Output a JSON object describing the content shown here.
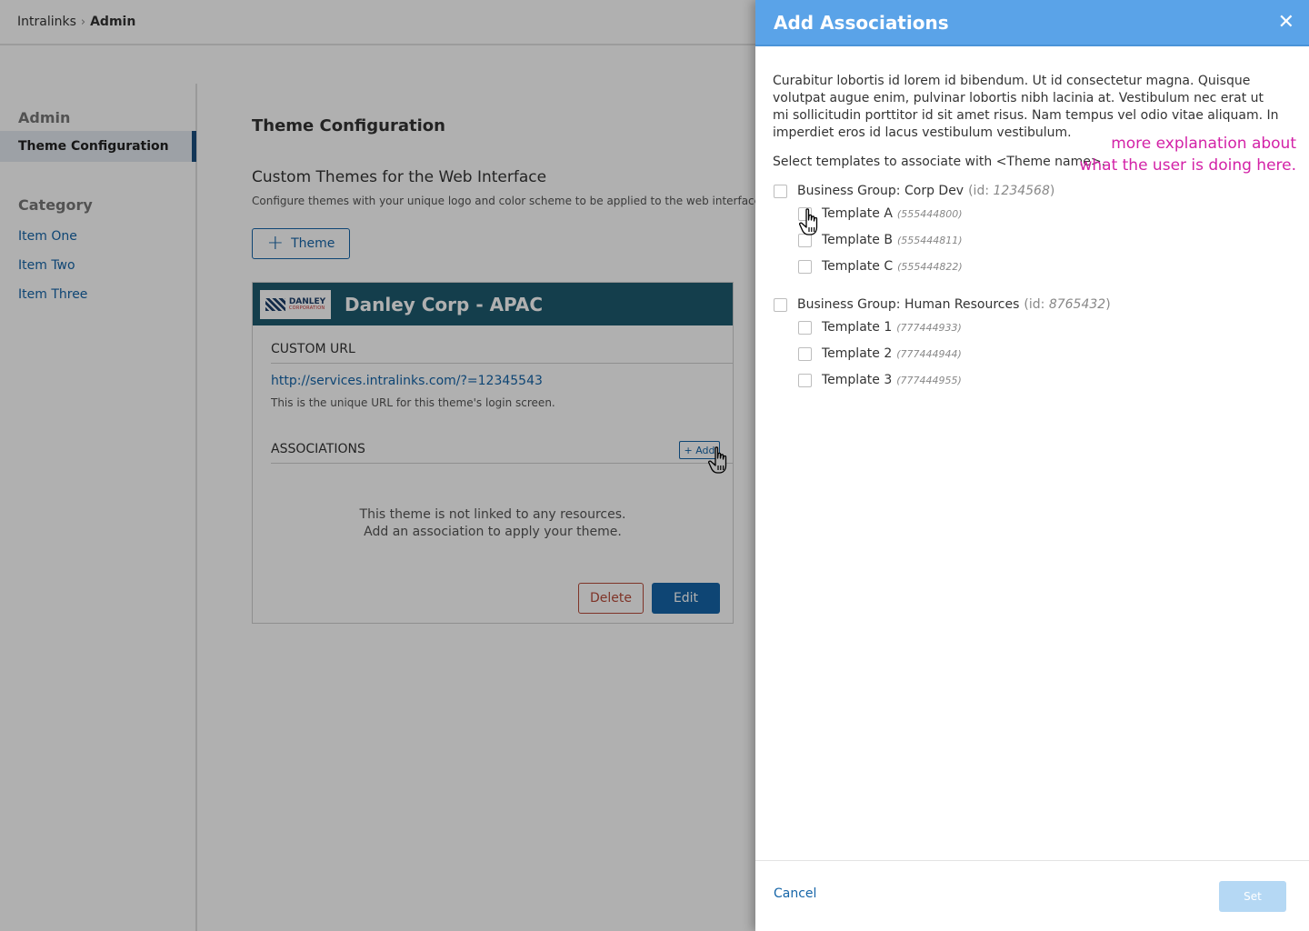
{
  "breadcrumb": {
    "root": "Intralinks",
    "current": "Admin"
  },
  "sidebar": {
    "title": "Admin",
    "active_item": "Theme Configuration",
    "category_title": "Category",
    "items": [
      {
        "label": "Item One"
      },
      {
        "label": "Item Two"
      },
      {
        "label": "Item Three"
      }
    ]
  },
  "main": {
    "title": "Theme Configuration",
    "subtitle": "Custom Themes for the Web Interface",
    "description": "Configure themes with your unique logo and color scheme to be applied to the web interface.",
    "theme_button": "Theme"
  },
  "card": {
    "logo_line1": "DANLEY",
    "logo_line2": "CORPORATION",
    "title": "Danley Corp - APAC",
    "custom_url_label": "CUSTOM URL",
    "url": "http://services.intralinks.com/?=12345543",
    "url_hint": "This is the unique URL for this theme's login screen.",
    "associations_label": "ASSOCIATIONS",
    "add_button": "+ Add",
    "empty_line1": "This theme is not linked to any resources.",
    "empty_line2": "Add an association to apply your theme.",
    "delete_button": "Delete",
    "edit_button": "Edit",
    "header_color": "#1d5a6f"
  },
  "panel": {
    "title": "Add Associations",
    "header_color": "#5aa3e8",
    "description": "Curabitur lobortis id lorem id bibendum. Ut id consectetur magna. Quisque volutpat augue enim, pulvinar lobortis nibh lacinia at. Vestibulum nec erat ut mi sollicitudin porttitor id sit amet risus. Nam tempus vel odio vitae aliquam. In imperdiet eros id lacus vestibulum vestibulum.",
    "instruction": "Select templates to associate with <Theme name>.",
    "annotation_line1": "more explanation about",
    "annotation_line2": "what the user is doing here.",
    "annotation_color": "#d322a7",
    "groups": [
      {
        "label": "Business Group: Corp Dev",
        "id_prefix": "(id: ",
        "id": "1234568",
        "id_suffix": ")",
        "templates": [
          {
            "label": "Template A",
            "id": "(555444800)"
          },
          {
            "label": "Template B",
            "id": "(555444811)"
          },
          {
            "label": "Template C",
            "id": "(555444822)"
          }
        ]
      },
      {
        "label": "Business Group: Human Resources",
        "id_prefix": "(id: ",
        "id": "8765432",
        "id_suffix": ")",
        "templates": [
          {
            "label": "Template 1",
            "id": "(777444933)"
          },
          {
            "label": "Template 2",
            "id": "(777444944)"
          },
          {
            "label": "Template 3",
            "id": "(777444955)"
          }
        ]
      }
    ],
    "cancel": "Cancel",
    "set": "Set"
  },
  "accent_color": "#1565a8"
}
